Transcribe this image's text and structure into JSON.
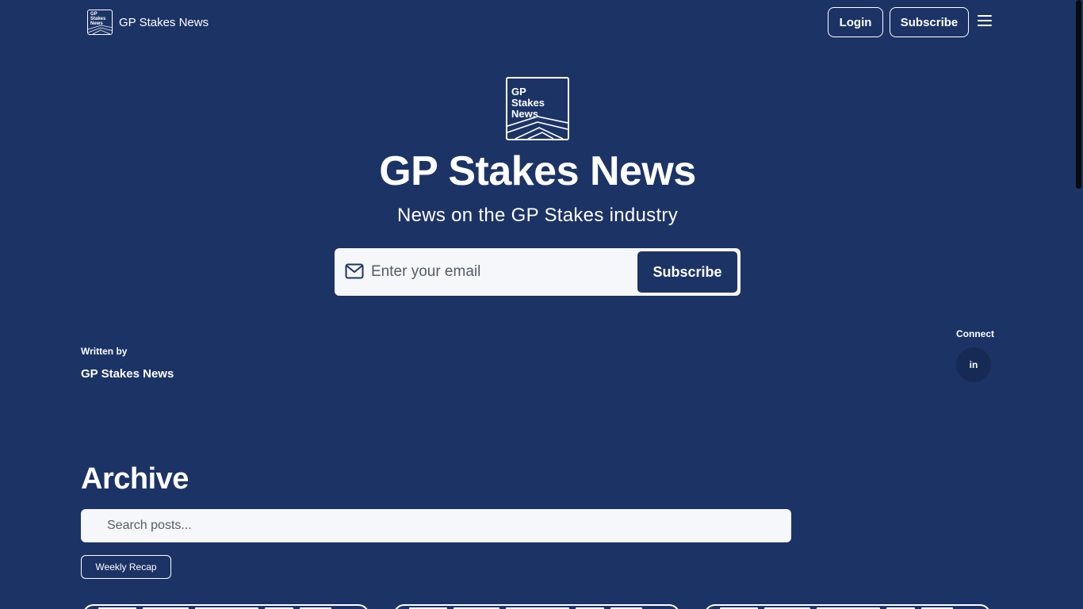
{
  "header": {
    "brand_name": "GP Stakes News",
    "logo_text": [
      "GP",
      "Stakes",
      "News"
    ],
    "login_label": "Login",
    "subscribe_label": "Subscribe",
    "menu_icon": "hamburger-icon"
  },
  "hero": {
    "logo_text": [
      "GP",
      "Stakes",
      "News"
    ],
    "title": "GP Stakes News",
    "subtitle": "News on the GP Stakes industry",
    "email_placeholder": "Enter your email",
    "email_icon": "mail-icon",
    "subscribe_label": "Subscribe"
  },
  "author": {
    "label": "Written by",
    "name": "GP Stakes News"
  },
  "connect": {
    "label": "Connect",
    "linkedin_text": "in",
    "icon": "linkedin-icon"
  },
  "archive": {
    "title": "Archive",
    "search_placeholder": "Search posts...",
    "tags": [
      "Weekly Recap"
    ]
  },
  "colors": {
    "background": "#1c3366",
    "input_background": "#f5f7fa",
    "text": "#ffffff"
  }
}
